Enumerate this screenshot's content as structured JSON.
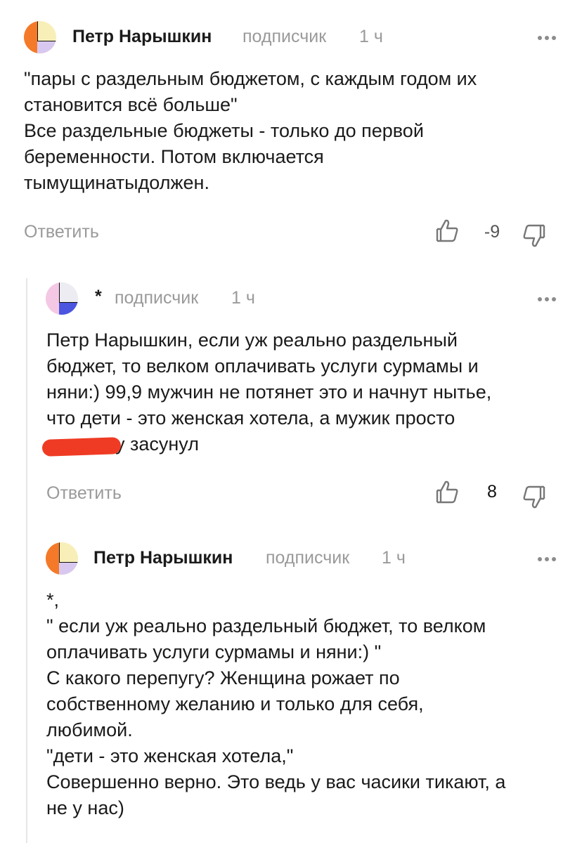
{
  "comments": [
    {
      "author": "Петр Нарышкин",
      "role": "подписчик",
      "time": "1 ч",
      "text": "\"пары с раздельным бюджетом, с каждым годом их\nстановится всё больше\"\nВсе раздельные бюджеты - только до первой\nбеременности. Потом включается\nтымущинатыдолжен.",
      "reply_label": "Ответить",
      "score": "-9"
    },
    {
      "author": "*",
      "role": "подписчик",
      "time": "1 ч",
      "text_lines": [
        "Петр Нарышкин, если уж реально раздельный",
        "бюджет, то велком оплачивать услуги сурмамы и",
        "няни:) 99,9 мужчин не потянет это и начнут нытье,",
        "что дети - это женская хотела, а мужик просто"
      ],
      "text_tail": "у засунул",
      "reply_label": "Ответить",
      "score": "8"
    },
    {
      "author": "Петр Нарышкин",
      "role": "подписчик",
      "time": "1 ч",
      "text": "*,\n\" если уж реально раздельный бюджет, то велком\nоплачивать услуги сурмамы и няни:) \"\nС какого перепугу? Женщина рожает по\nсобственному желанию и только для себя,\nлюбимой.\n\"дети - это женская хотела,\"\nСовершенно верно. Это ведь у вас часики тикают, а\nне у нас)"
    }
  ],
  "colors": {
    "avatar_orange": "#f47a2a",
    "avatar_yellow": "#f8efb8",
    "avatar_lilac": "#d8c8f0",
    "avatar_pink": "#f4c8e4",
    "avatar_blue": "#4b55e0",
    "redaction": "#ef3b24"
  },
  "icons": [
    "avatar-icon",
    "more-options-icon",
    "thumbs-up-icon",
    "thumbs-down-icon"
  ]
}
